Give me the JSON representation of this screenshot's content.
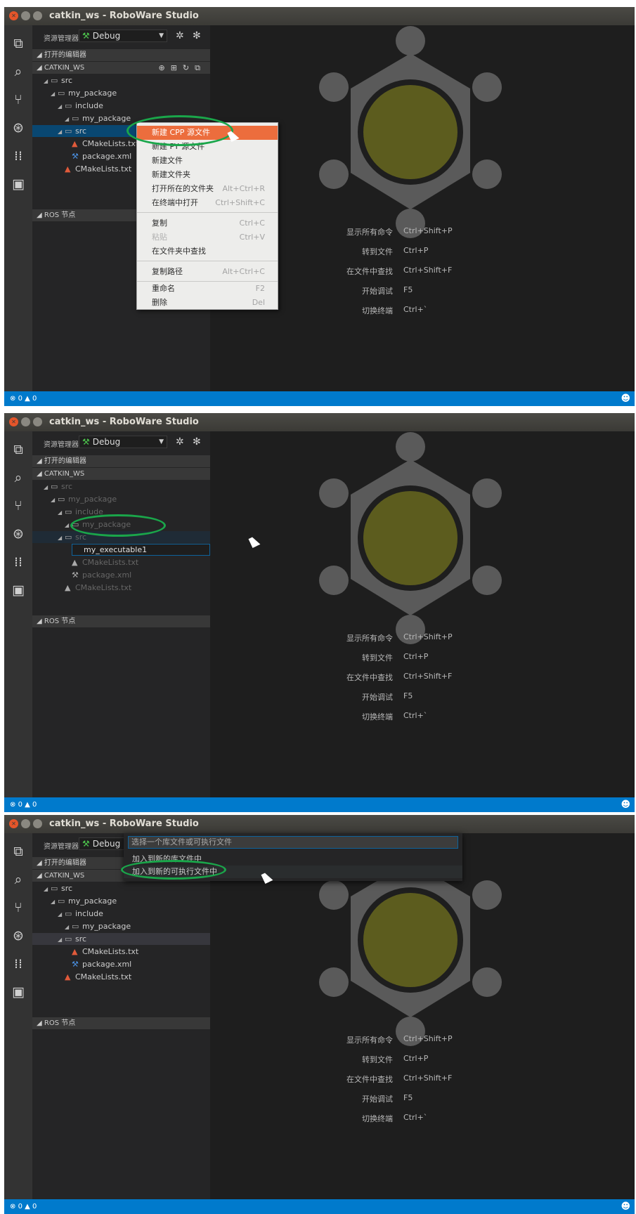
{
  "window": {
    "title": "catkin_ws - RoboWare Studio"
  },
  "explorer": {
    "title": "资源管理器",
    "config_value": "Debug",
    "open_editors_label": "打开的编辑器",
    "workspace_label": "CATKIN_WS",
    "ros_nodes_label": "ROS 节点"
  },
  "tree": {
    "src": "src",
    "my_package": "my_package",
    "include": "include",
    "my_package_inner": "my_package",
    "src_inner": "src",
    "cmakelists_inner": "CMakeLists.txt",
    "package_xml": "package.xml",
    "cmakelists_root": "CMakeLists.txt"
  },
  "rename": {
    "value": "my_executable1"
  },
  "welcome": {
    "commands": [
      {
        "label": "显示所有命令",
        "key": "Ctrl+Shift+P"
      },
      {
        "label": "转到文件",
        "key": "Ctrl+P"
      },
      {
        "label": "在文件中查找",
        "key": "Ctrl+Shift+F"
      },
      {
        "label": "开始调试",
        "key": "F5"
      },
      {
        "label": "切换终端",
        "key": "Ctrl+`"
      }
    ]
  },
  "status": {
    "errors": "0",
    "warnings": "0"
  },
  "context_menu": {
    "items": [
      {
        "label": "新建 CPP 源文件",
        "key": ""
      },
      {
        "label": "新建 PY 源文件",
        "key": ""
      },
      {
        "label": "新建文件",
        "key": ""
      },
      {
        "label": "新建文件夹",
        "key": ""
      },
      {
        "label": "打开所在的文件夹",
        "key": "Alt+Ctrl+R"
      },
      {
        "label": "在终端中打开",
        "key": "Ctrl+Shift+C"
      },
      {
        "label": "复制",
        "key": "Ctrl+C"
      },
      {
        "label": "粘贴",
        "key": "Ctrl+V"
      },
      {
        "label": "在文件夹中查找",
        "key": ""
      },
      {
        "label": "复制路径",
        "key": "Alt+Ctrl+C"
      },
      {
        "label": "重命名",
        "key": "F2"
      },
      {
        "label": "删除",
        "key": "Del"
      }
    ]
  },
  "quick_pick": {
    "placeholder": "选择一个库文件或可执行文件",
    "items": [
      "加入到新的库文件中",
      "加入到新的可执行文件中"
    ]
  },
  "colors": {
    "statusbar": "#007acc",
    "menu_highlight": "#ec6d3d",
    "annotation_ring": "#1aa64a",
    "logo_gray": "#5a5a5a",
    "logo_center": "#5c5c1e"
  }
}
